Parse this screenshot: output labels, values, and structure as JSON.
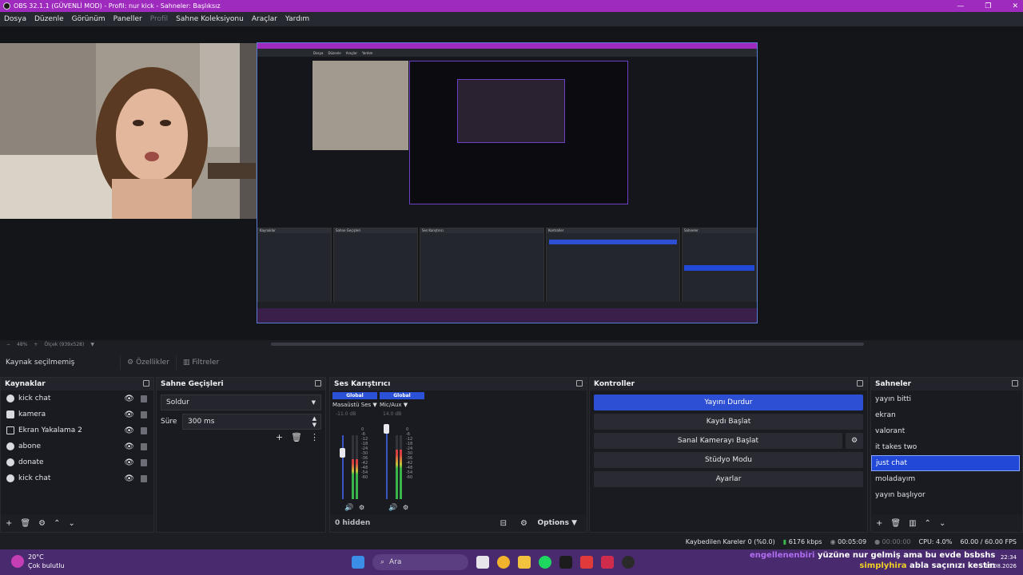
{
  "window": {
    "title": "OBS 32.1.1 (GÜVENLİ MOD) - Profil: nur kick - Sahneler: Başlıksız"
  },
  "menu": {
    "items": [
      "Dosya",
      "Düzenle",
      "Görünüm",
      "Paneller",
      "Profil",
      "Sahne Koleksiyonu",
      "Araçlar",
      "Yardım"
    ],
    "disabled": [
      "Profil"
    ]
  },
  "zoom": {
    "minus": "−",
    "percent": "48%",
    "plus": "+",
    "scale": "Ölçek (939x528)"
  },
  "sourcebar": {
    "no_source": "Kaynak seçilmemiş",
    "properties": "Özellikler",
    "filters": "Filtreler"
  },
  "sources": {
    "title": "Kaynaklar",
    "items": [
      {
        "label": "kick chat",
        "icon": "browser-icon"
      },
      {
        "label": "kamera",
        "icon": "camera-icon"
      },
      {
        "label": "Ekran Yakalama 2",
        "icon": "display-icon"
      },
      {
        "label": "abone",
        "icon": "browser-icon"
      },
      {
        "label": "donate",
        "icon": "browser-icon"
      },
      {
        "label": "kick chat",
        "icon": "browser-icon"
      }
    ]
  },
  "transitions": {
    "title": "Sahne Geçişleri",
    "selected": "Soldur",
    "duration_label": "Süre",
    "duration_value": "300 ms"
  },
  "mixer": {
    "title": "Ses Karıştırıcı",
    "channels": [
      {
        "badge": "Global",
        "name": "Masaüstü Ses",
        "db": "-11.0 dB",
        "level": 0.62
      },
      {
        "badge": "Global",
        "name": "Mic/Aux",
        "db": "14.0 dB",
        "level": 0.78
      }
    ],
    "ticks": [
      "0",
      "-6",
      "-12",
      "-18",
      "-24",
      "-30",
      "-36",
      "-42",
      "-48",
      "-54",
      "-60"
    ],
    "hidden": "0 hidden",
    "options": "Options"
  },
  "controls": {
    "title": "Kontroller",
    "buttons": [
      "Yayını Durdur",
      "Kaydı Başlat",
      "Sanal Kamerayı Başlat",
      "Stüdyo Modu",
      "Ayarlar"
    ]
  },
  "scenes": {
    "title": "Sahneler",
    "items": [
      "yayın bitti",
      "ekran",
      "valorant",
      "it takes two",
      "just chat",
      "moladayım",
      "yayın başlıyor"
    ],
    "selected": "just chat"
  },
  "status": {
    "dropped": "Kaybedilen Kareler 0 (%0.0)",
    "bitrate": "6176 kbps",
    "live_time": "00:05:09",
    "rec_time": "00:00:00",
    "cpu": "CPU: 4.0%",
    "fps": "60.00 / 60.00 FPS"
  },
  "taskbar": {
    "temp": "20°C",
    "weather": "Çok bulutlu",
    "search": "Ara",
    "chat_user1": "engellenenbiri",
    "chat_msg1": "yüzüne nur gelmiş ama bu evde bsbshs",
    "chat_user2": "simplyhira",
    "chat_msg2": "abla saçınızı kestin",
    "time": "22:34",
    "date": "16.08.2026"
  },
  "colors": {
    "accent": "#2d4fd3",
    "titlebar": "#9e2bbd",
    "taskbar": "#4a2a6f"
  }
}
